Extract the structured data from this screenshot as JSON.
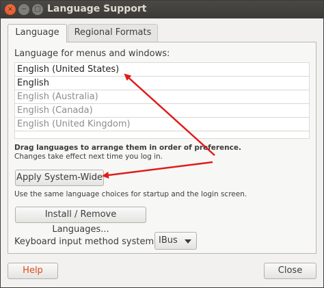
{
  "window": {
    "title": "Language Support",
    "controls": {
      "close": "×",
      "minimize": "−",
      "maximize": "□"
    }
  },
  "tabs": [
    {
      "label": "Language",
      "selected": true
    },
    {
      "label": "Regional Formats",
      "selected": false
    }
  ],
  "language_section": {
    "label": "Language for menus and windows:",
    "items": [
      {
        "label": "English (United States)",
        "active": true
      },
      {
        "label": "English",
        "active": true
      },
      {
        "label": "English (Australia)",
        "active": false
      },
      {
        "label": "English (Canada)",
        "active": false
      },
      {
        "label": "English (United Kingdom)",
        "active": false
      }
    ],
    "drag_hint": "Drag languages to arrange them in order of preference.",
    "change_hint": "Changes take effect next time you log in."
  },
  "apply_button": {
    "label": "Apply System-Wide"
  },
  "same_hint": "Use the same language choices for startup and the login screen.",
  "install_button": {
    "label": "Install / Remove Languages..."
  },
  "keyboard": {
    "label": "Keyboard input method system:",
    "selected": "IBus"
  },
  "footer": {
    "help_label": "Help",
    "close_label": "Close"
  },
  "colors": {
    "annotation_arrow": "#e01b1b",
    "help_text": "#df4a16",
    "titlebar": "#3b3a36"
  }
}
